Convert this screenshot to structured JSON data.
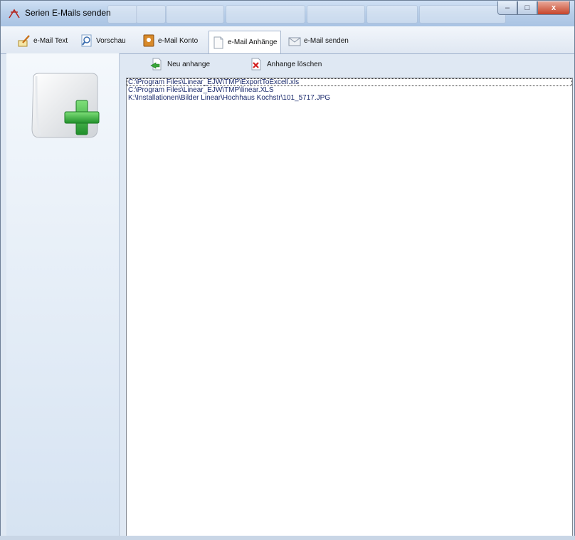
{
  "window": {
    "title": "Serien E-Mails senden",
    "minimize": "–",
    "maximize": "□",
    "close": "x"
  },
  "tabs": [
    {
      "label": "e-Mail Text",
      "icon": "pen-letter-icon"
    },
    {
      "label": "Vorschau",
      "icon": "magnifier-icon"
    },
    {
      "label": "e-Mail Konto",
      "icon": "address-book-icon"
    },
    {
      "label": "e-Mail Anhänge",
      "icon": "attachment-page-icon"
    },
    {
      "label": "e-Mail senden",
      "icon": "envelope-send-icon"
    }
  ],
  "active_tab": "e-Mail Anhänge",
  "toolbar": {
    "new_label": "Neu anhange",
    "delete_label": "Anhange löschen"
  },
  "attachments": [
    "C:\\Program Files\\Linear_EJW\\TMP\\ExportToExcell.xls",
    "C:\\Program Files\\Linear_EJW\\TMP\\linear.XLS",
    "K:\\Installationen\\Bilder Linear\\Hochhaus Kochstr\\101_5717.JPG"
  ],
  "colors": {
    "accent_green": "#3aa63a",
    "list_text": "#1a2a6c",
    "delete_red": "#d32020"
  }
}
